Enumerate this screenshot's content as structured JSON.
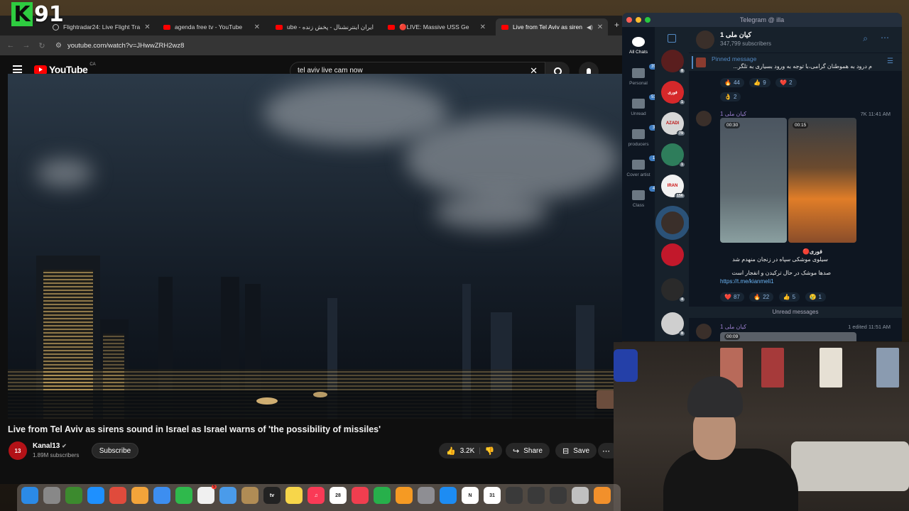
{
  "overlay": {
    "logo_letter": "K",
    "logo_number": "91"
  },
  "browser": {
    "tabs": [
      {
        "label": "Flightradar24: Live Flight Tra",
        "favicon": "globe-icon"
      },
      {
        "label": "agenda free tv - YouTube",
        "favicon": "youtube-icon"
      },
      {
        "label": "ube - ایران اینترنشنال - پخش زنده",
        "favicon": "youtube-icon"
      },
      {
        "label": "🔴LIVE: Massive USS Ge",
        "favicon": "youtube-icon"
      },
      {
        "label": "Live from Tel Aviv as siren",
        "favicon": "youtube-icon",
        "active": true
      }
    ],
    "url": "youtube.com/watch?v=JHwwZRH2wz8"
  },
  "youtube": {
    "logo_text": "YouTube",
    "country_code": "CA",
    "search_query": "tel aviv live cam now",
    "video_title": "Live from Tel Aviv as sirens sound in Israel as Israel warns of 'the possibility of missiles'",
    "channel": {
      "name": "Kanal13",
      "avatar_text": "13",
      "subscribers": "1.89M subscribers"
    },
    "subscribe_label": "Subscribe",
    "likes": "3.2K",
    "share_label": "Share",
    "save_label": "Save"
  },
  "telegram": {
    "window_title": "Telegram @ illa",
    "folders": [
      {
        "label": "All Chats",
        "badge": ""
      },
      {
        "label": "Personal",
        "badge": "395"
      },
      {
        "label": "Unread",
        "badge": "538"
      },
      {
        "label": "producers",
        "badge": "3"
      },
      {
        "label": "Cover artist",
        "badge": "1"
      },
      {
        "label": "Class",
        "badge": "4"
      }
    ],
    "chats": [
      {
        "badge": "8",
        "color": "#5a1e1e",
        "text": ""
      },
      {
        "badge": "1",
        "color": "#d6282a",
        "text": "فوری"
      },
      {
        "badge": "79",
        "color": "#d7d7d7",
        "text": "AZADI"
      },
      {
        "badge": "1",
        "color": "#2e7d5b",
        "text": ""
      },
      {
        "badge": "156",
        "color": "#f2f2f2",
        "text": "IRAN"
      },
      {
        "badge": "",
        "color": "#3a2f2a",
        "text": ""
      },
      {
        "badge": "",
        "color": "#c2182b",
        "text": ""
      },
      {
        "badge": "4",
        "color": "#2a2a2a",
        "text": ""
      },
      {
        "badge": "8",
        "color": "#cfcfcf",
        "text": ""
      }
    ],
    "channel_name": "کیان ملی 1",
    "channel_subscribers": "347,799 subscribers",
    "pinned_label": "Pinned message",
    "pinned_text": "م درود به هموطنان گرامی،با توجه به ورود بسیاری به تلگر...",
    "first_reactions": [
      {
        "emoji": "🔥",
        "count": "44"
      },
      {
        "emoji": "👍",
        "count": "9"
      },
      {
        "emoji": "❤️",
        "count": "2"
      },
      {
        "emoji": "👌",
        "count": "2"
      }
    ],
    "message": {
      "author": "کیان ملی 1",
      "meta": "7K 11:41 AM",
      "video1_duration": "00:30",
      "video2_duration": "00:15",
      "line1": "فوری🔴",
      "line2": "سیلوی موشکی سپاه در زنجان منهدم شد",
      "line3": "صدها موشک در حال ترکیدن و انفجار است",
      "link": "https://t.me/kianmeli1",
      "reactions": [
        {
          "emoji": "❤️",
          "count": "87"
        },
        {
          "emoji": "🔥",
          "count": "22"
        },
        {
          "emoji": "👍",
          "count": "5"
        },
        {
          "emoji": "😢",
          "count": "1"
        }
      ]
    },
    "unread_label": "Unread messages",
    "next_message": {
      "author": "کیان ملی 1",
      "meta": "1 edited 11:51 AM",
      "duration": "00:09"
    }
  },
  "dock": {
    "apps": [
      {
        "name": "finder-icon",
        "color": "#2b8ae6",
        "text": ""
      },
      {
        "name": "launchpad-icon",
        "color": "#888888",
        "text": ""
      },
      {
        "name": "app-icon",
        "color": "#3c8a2e",
        "text": ""
      },
      {
        "name": "safari-icon",
        "color": "#1e90ff",
        "text": ""
      },
      {
        "name": "chrome-icon",
        "color": "#e04b3c",
        "text": ""
      },
      {
        "name": "photos-icon",
        "color": "#f3a43a",
        "text": ""
      },
      {
        "name": "mail-icon",
        "color": "#3d8ef0",
        "text": ""
      },
      {
        "name": "facetime-icon",
        "color": "#2fb94c",
        "text": ""
      },
      {
        "name": "reminders-icon",
        "color": "#f0f0f0",
        "text": "",
        "badge": "5"
      },
      {
        "name": "freeform-icon",
        "color": "#4a9bea",
        "text": ""
      },
      {
        "name": "app-icon",
        "color": "#b08c55",
        "text": ""
      },
      {
        "name": "tv-icon",
        "color": "#222222",
        "text": "tv"
      },
      {
        "name": "notes-icon",
        "color": "#f7d64a",
        "text": ""
      },
      {
        "name": "music-icon",
        "color": "#fa3a56",
        "text": "♫"
      },
      {
        "name": "calendar-icon",
        "color": "#ffffff",
        "text": "28"
      },
      {
        "name": "news-icon",
        "color": "#f03e4f",
        "text": ""
      },
      {
        "name": "numbers-icon",
        "color": "#27b04b",
        "text": ""
      },
      {
        "name": "pages-icon",
        "color": "#f59a23",
        "text": ""
      },
      {
        "name": "settings-icon",
        "color": "#8e8e93",
        "text": ""
      },
      {
        "name": "appstore-icon",
        "color": "#1d8cf3",
        "text": ""
      },
      {
        "name": "notion-icon",
        "color": "#ffffff",
        "text": "N"
      },
      {
        "name": "calendar-app-icon",
        "color": "#ffffff",
        "text": "31"
      },
      {
        "name": "app-icon",
        "color": "#3a3a3a",
        "text": ""
      },
      {
        "name": "app-icon",
        "color": "#3a3a3a",
        "text": ""
      },
      {
        "name": "app-icon",
        "color": "#3a3a3a",
        "text": ""
      },
      {
        "name": "app-icon",
        "color": "#c0c0c0",
        "text": ""
      },
      {
        "name": "app-icon",
        "color": "#f2902b",
        "text": ""
      }
    ]
  }
}
